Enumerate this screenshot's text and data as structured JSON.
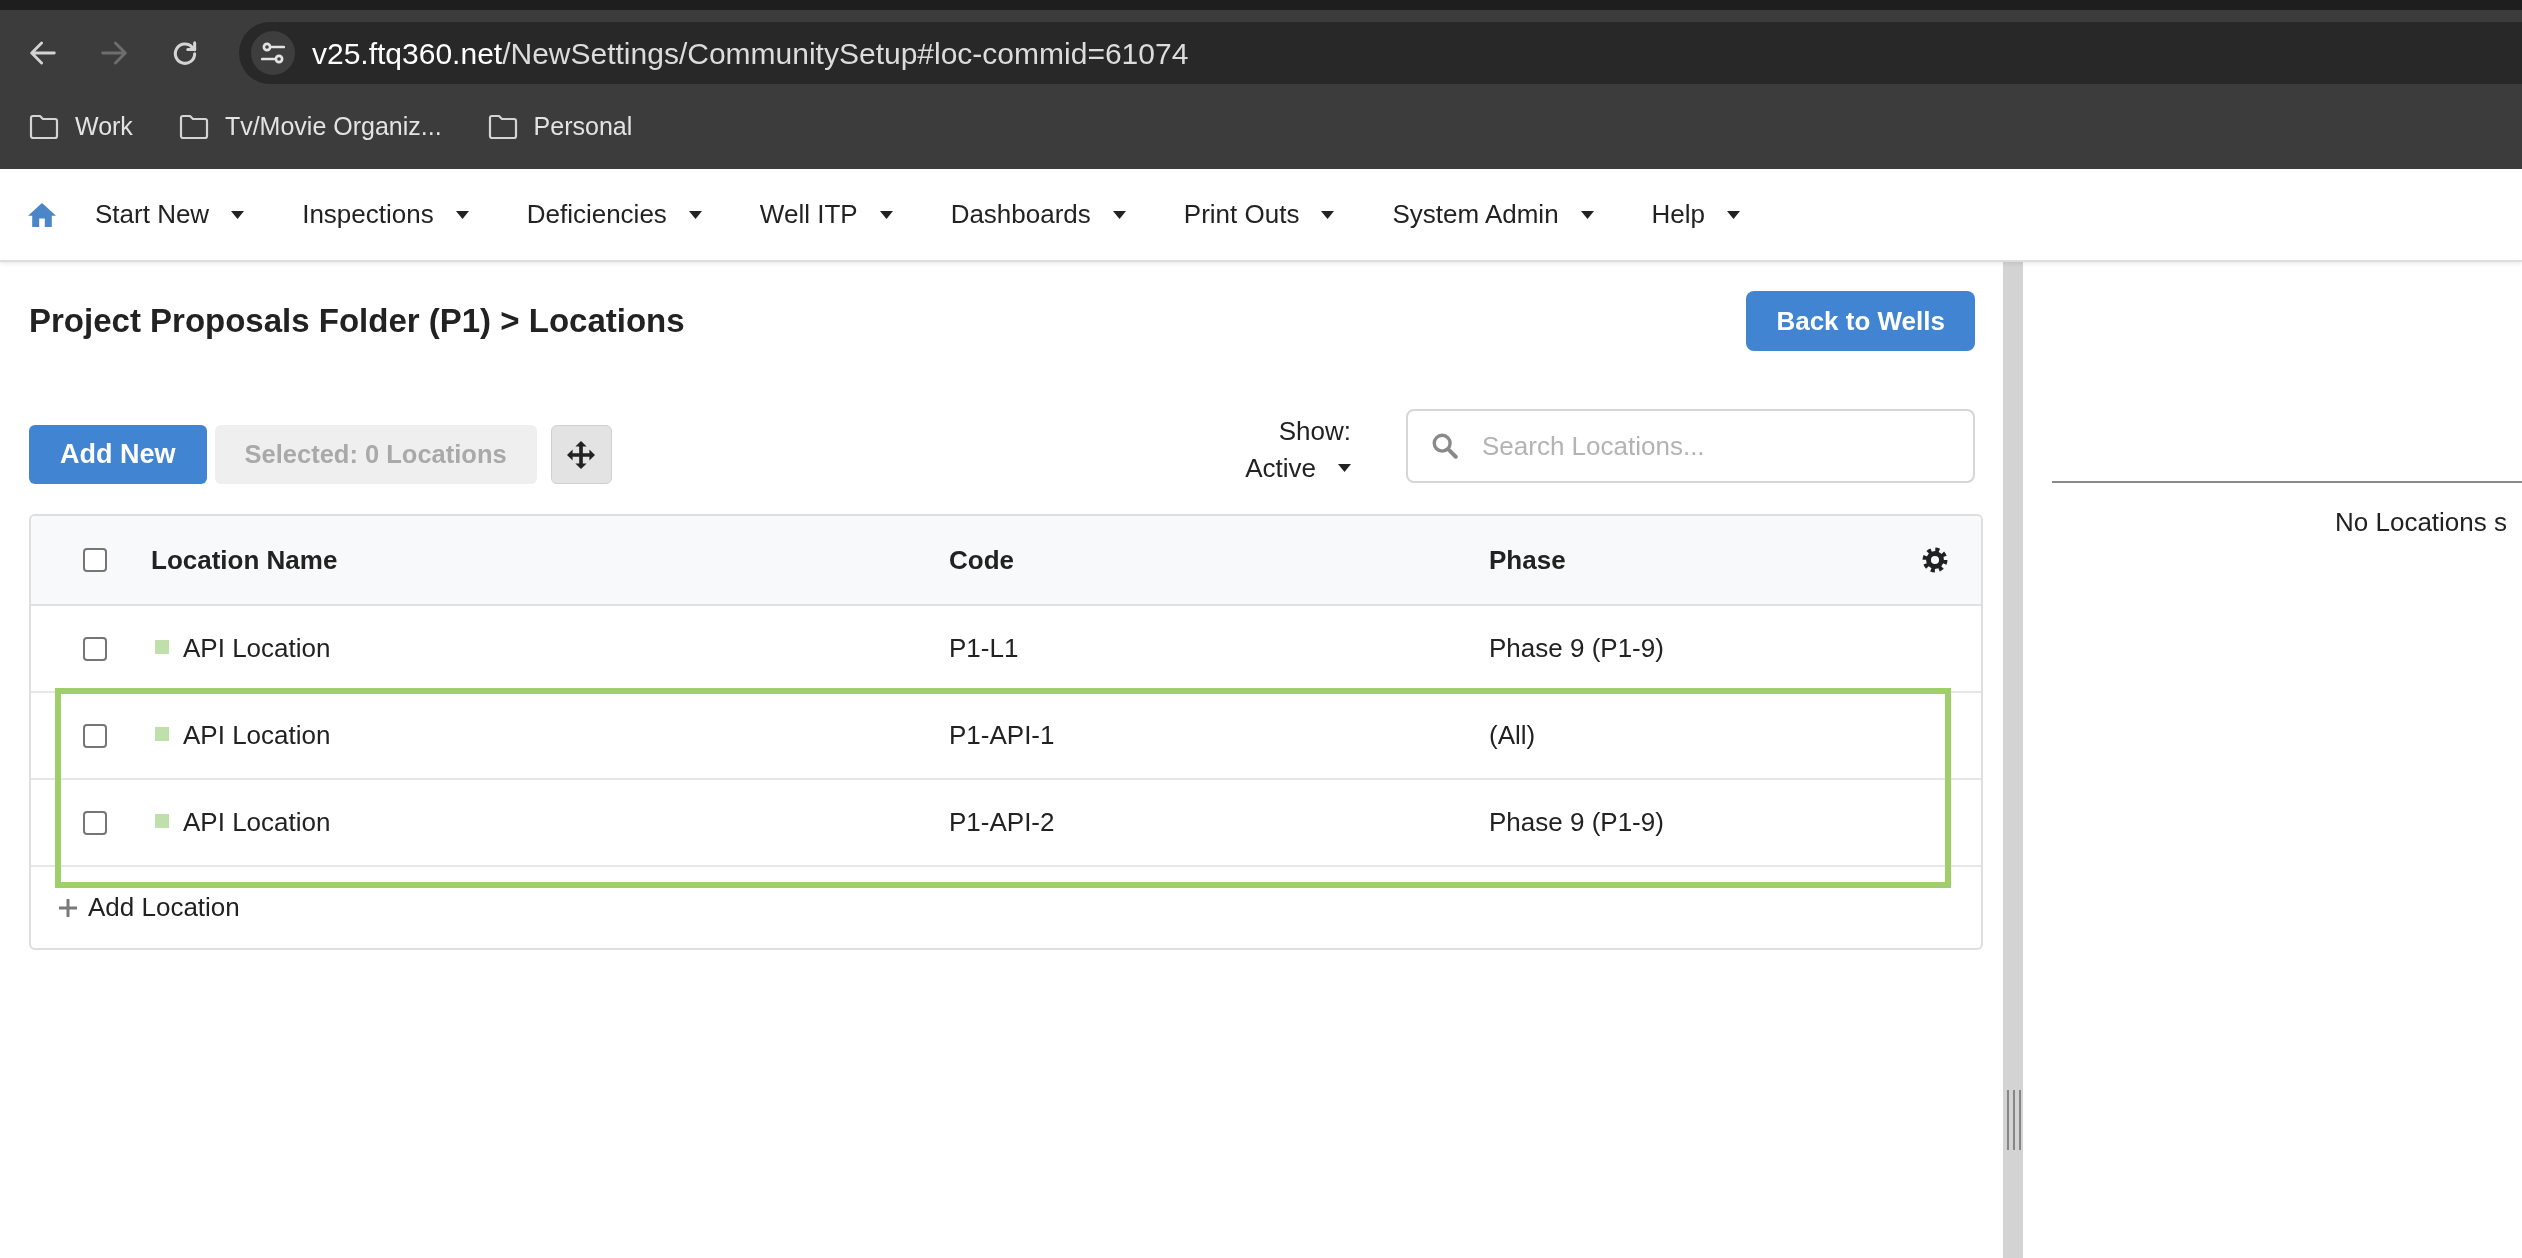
{
  "browser": {
    "nav_buttons": [
      {
        "kind": "back",
        "disabled": false
      },
      {
        "kind": "forward",
        "disabled": true
      },
      {
        "kind": "reload",
        "disabled": false
      }
    ],
    "address_bar": {
      "host": "v25.ftq360.net",
      "path": "/NewSettings/CommunitySetup#loc-commid=61074"
    },
    "bookmarks": [
      {
        "label": "Work"
      },
      {
        "label": "Tv/Movie Organiz..."
      },
      {
        "label": "Personal"
      }
    ]
  },
  "nav_menu": {
    "items": [
      {
        "label": "Start New"
      },
      {
        "label": "Inspections"
      },
      {
        "label": "Deficiencies"
      },
      {
        "label": "Well ITP"
      },
      {
        "label": "Dashboards"
      },
      {
        "label": "Print Outs"
      },
      {
        "label": "System Admin"
      },
      {
        "label": "Help"
      }
    ]
  },
  "page": {
    "title": "Project Proposals Folder (P1) > Locations",
    "back_button": "Back to Wells"
  },
  "toolbar": {
    "add_button": "Add New",
    "selection_button": {
      "label": "Selected: 0 Locations",
      "disabled": true
    },
    "show_filter": {
      "label": "Show:",
      "value": "Active"
    },
    "search": {
      "placeholder": "Search Locations..."
    }
  },
  "table": {
    "select_all": {
      "checked": false
    },
    "columns": [
      {
        "label": "Location Name"
      },
      {
        "label": "Code"
      },
      {
        "label": "Phase"
      }
    ],
    "rows": [
      {
        "checked": false,
        "highlighted": false,
        "color": "#bfe0aa",
        "cells": [
          "API Location",
          "P1-L1",
          "Phase 9 (P1-9)"
        ]
      },
      {
        "checked": false,
        "highlighted": true,
        "color": "#bfe0aa",
        "cells": [
          "API Location",
          "P1-API-1",
          "(All)"
        ]
      },
      {
        "checked": false,
        "highlighted": true,
        "color": "#bfe0aa",
        "cells": [
          "API Location",
          "P1-API-2",
          "Phase 9 (P1-9)"
        ]
      }
    ],
    "add_row": {
      "label": "Add Location"
    }
  },
  "details_panel": {
    "message": "No Locations s"
  }
}
